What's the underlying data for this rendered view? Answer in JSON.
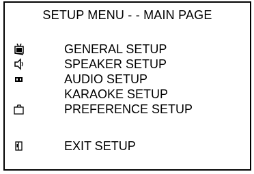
{
  "header": {
    "title": "SETUP MENU  - -  MAIN PAGE"
  },
  "menu": {
    "items": [
      {
        "label": "GENERAL SETUP",
        "icon": "tv-icon"
      },
      {
        "label": "SPEAKER SETUP",
        "icon": "speaker-icon"
      },
      {
        "label": "AUDIO SETUP",
        "icon": "cassette-icon"
      },
      {
        "label": "KARAOKE SETUP",
        "icon": ""
      },
      {
        "label": "PREFERENCE SETUP",
        "icon": "folder-icon"
      },
      {
        "label": "EXIT SETUP",
        "icon": "exit-door-icon"
      }
    ]
  }
}
